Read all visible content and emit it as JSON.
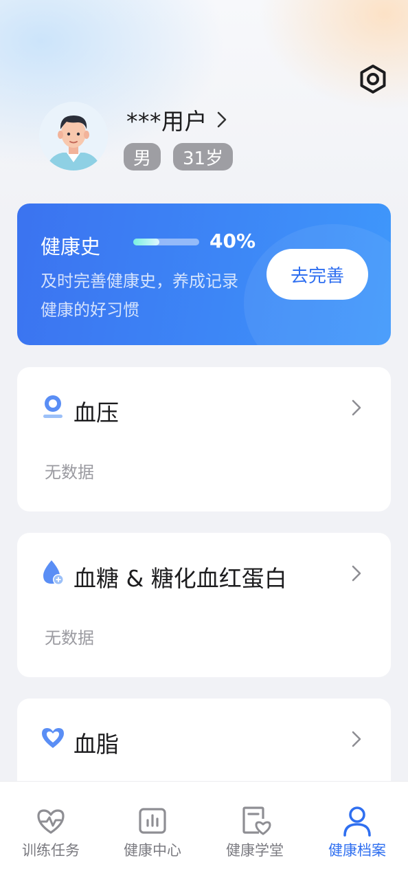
{
  "profile": {
    "username": "***用户",
    "gender": "男",
    "age": "31岁"
  },
  "health_history": {
    "title": "健康史",
    "progress_label": "40%",
    "progress_value": 0.4,
    "description": "及时完善健康史，养成记录健康的好习惯",
    "button_label": "去完善"
  },
  "metrics": [
    {
      "title": "血压",
      "value": "无数据",
      "icon": "blood-pressure-icon"
    },
    {
      "title": "血糖 & 糖化血红蛋白",
      "value": "无数据",
      "icon": "blood-sugar-icon"
    },
    {
      "title": "血脂",
      "value": "",
      "icon": "blood-lipid-icon"
    }
  ],
  "bottom_nav": {
    "items": [
      {
        "label": "训练任务",
        "icon": "heart-pulse-icon"
      },
      {
        "label": "健康中心",
        "icon": "chart-icon"
      },
      {
        "label": "健康学堂",
        "icon": "document-heart-icon"
      },
      {
        "label": "健康档案",
        "icon": "user-icon"
      }
    ],
    "active_index": 3
  },
  "colors": {
    "accent": "#2f6ff0",
    "card_gradient_start": "#3b73f0",
    "card_gradient_end": "#3f98fb",
    "muted_text": "#9a9aa0",
    "tag_bg": "#9e9ea3"
  }
}
